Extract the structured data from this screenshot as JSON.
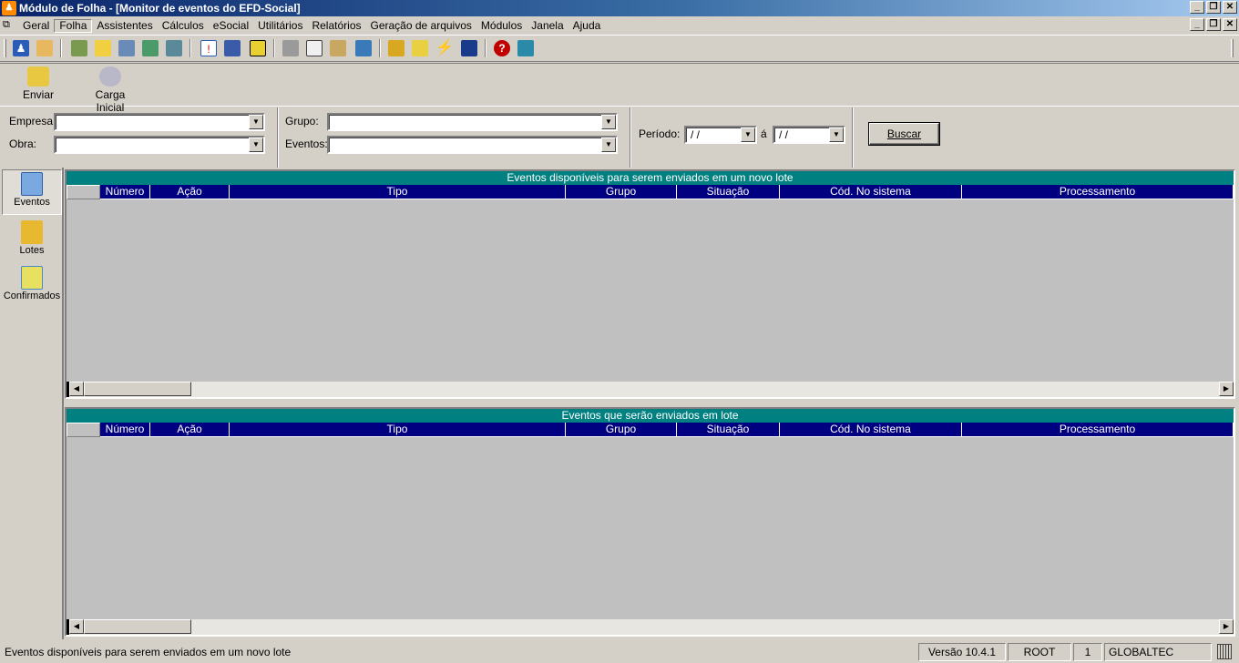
{
  "window": {
    "title": "Módulo de Folha - [Monitor de eventos do EFD-Social]"
  },
  "menu": {
    "items": [
      "Geral",
      "Folha",
      "Assistentes",
      "Cálculos",
      "eSocial",
      "Utilitários",
      "Relatórios",
      "Geração de arquivos",
      "Módulos",
      "Janela",
      "Ajuda"
    ],
    "active": "Folha"
  },
  "toolbar": {
    "icons": [
      "users-icon",
      "notes-icon",
      "tools-icon",
      "window-star-icon",
      "tag-icon",
      "inbox-check-icon",
      "transfer-icon",
      "calendar-alert-icon",
      "ruler-icon",
      "card-icon",
      "print-icon",
      "copy-icon",
      "paste-icon",
      "monitor-icon",
      "lock-icon",
      "filter-icon",
      "lightning-icon",
      "grid-icon",
      "help-icon",
      "exit-icon"
    ]
  },
  "actions": {
    "send": "Enviar",
    "initial_load": "Carga Inicial"
  },
  "filters": {
    "company_label": "Empresa:",
    "work_label": "Obra:",
    "group_label": "Grupo:",
    "events_label": "Eventos:",
    "period_label": "Período:",
    "period_from": " / /",
    "period_sep": "á",
    "period_to": " / /",
    "search_button": "Buscar"
  },
  "nav": {
    "events": "Eventos",
    "batches": "Lotes",
    "confirmed": "Confirmados"
  },
  "grid_available": {
    "caption": "Eventos disponíveis para serem enviados em um novo lote",
    "columns": [
      "Número",
      "Ação",
      "Tipo",
      "Grupo",
      "Situação",
      "Cód. No sistema",
      "Processamento"
    ]
  },
  "grid_batch": {
    "caption": "Eventos que serão enviados em lote",
    "columns": [
      "Número",
      "Ação",
      "Tipo",
      "Grupo",
      "Situação",
      "Cód. No sistema",
      "Processamento"
    ]
  },
  "status": {
    "message": "Eventos disponíveis para serem enviados em um novo lote",
    "version": "Versão 10.4.1",
    "user": "ROOT",
    "number": "1",
    "company": "GLOBALTEC"
  }
}
